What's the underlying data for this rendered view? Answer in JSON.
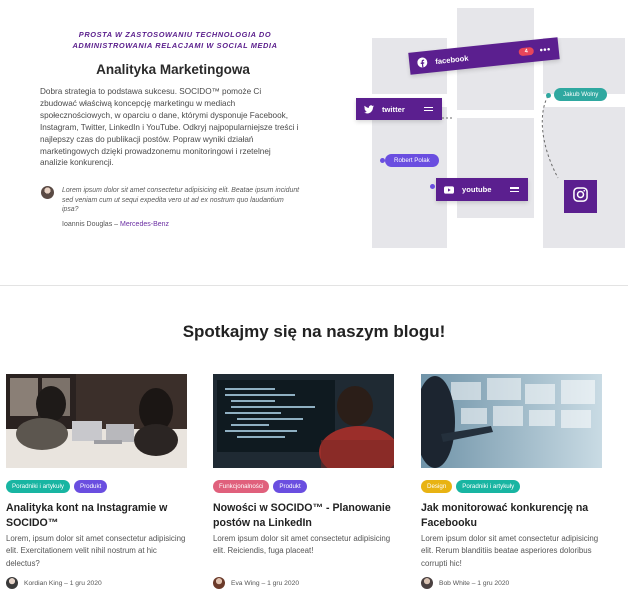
{
  "hero": {
    "tagline": "Prosta w zastosowaniu technologia do administrowania relacjami w social media",
    "title": "Analityka Marketingowa",
    "body": "Dobra strategia to podstawa sukcesu. SOCIDO™ pomoże Ci zbudować właściwą koncepcję marketingu w mediach społecznościowych, w oparciu o dane, którymi dysponuje Facebook, Instagram, Twitter, LinkedIn i YouTube. Odkryj najpopularniejsze treści i najlepszy czas do publikacji postów. Popraw wyniki działań marketingowych dzięki prowadzonemu monitoringowi i rzetelnej analizie konkurencji.",
    "quote": "Lorem ipsum dolor sit amet consectetur adipisicing elit. Beatae ipsum incidunt sed veniam cum ut sequi expedita vero ut ad ex nostrum quo laudantium ipsa?",
    "quote_author": "Ioannis Douglas",
    "quote_separator": " – ",
    "quote_company": "Mercedes-Benz"
  },
  "graphic": {
    "facebook_label": "facebook",
    "facebook_badge": "4",
    "facebook_more": "•••",
    "twitter_label": "twitter",
    "youtube_label": "youtube",
    "user_1": "Jakub Wolny",
    "user_2": "Robert Polak",
    "colors": {
      "chip": "#5b1f8f",
      "teal": "#2fa8a0",
      "purple_pill": "#6a4ee0",
      "badge": "#e8465a",
      "box": "#e6e6ea"
    },
    "icons": [
      "facebook-icon",
      "twitter-icon",
      "youtube-icon",
      "instagram-icon",
      "menu-icon"
    ]
  },
  "blog": {
    "title": "Spotkajmy się na naszym blogu!",
    "posts": [
      {
        "tags": [
          {
            "label": "Poradniki i artykuły",
            "color": "#18b5a2"
          },
          {
            "label": "Produkt",
            "color": "#6a4ee0"
          }
        ],
        "title": "Analityka kont na Instagramie w SOCIDO™",
        "excerpt": "Lorem, ipsum dolor sit amet consectetur adipisicing elit. Exercitationem velit nihil nostrum at hic delectus?",
        "author": "Kordian King",
        "date": "1 gru 2020"
      },
      {
        "tags": [
          {
            "label": "Funkcjonalności",
            "color": "#e0607c"
          },
          {
            "label": "Produkt",
            "color": "#6a4ee0"
          }
        ],
        "title": "Nowości w SOCIDO™ - Planowanie postów na LinkedIn",
        "excerpt": "Lorem ipsum dolor sit amet consectetur adipisicing elit. Reiciendis, fuga placeat!",
        "author": "Eva Wing",
        "date": "1 gru 2020"
      },
      {
        "tags": [
          {
            "label": "Design",
            "color": "#e8b313"
          },
          {
            "label": "Poradniki i artykuły",
            "color": "#18b5a2"
          }
        ],
        "title": "Jak monitorować konkurencję na Facebooku",
        "excerpt": "Lorem ipsum dolor sit amet consectetur adipisicing elit. Rerum blanditiis beatae asperiores doloribus corrupti hic!",
        "author": "Bob White",
        "date": "1 gru 2020"
      }
    ],
    "meta_separator": " – "
  }
}
